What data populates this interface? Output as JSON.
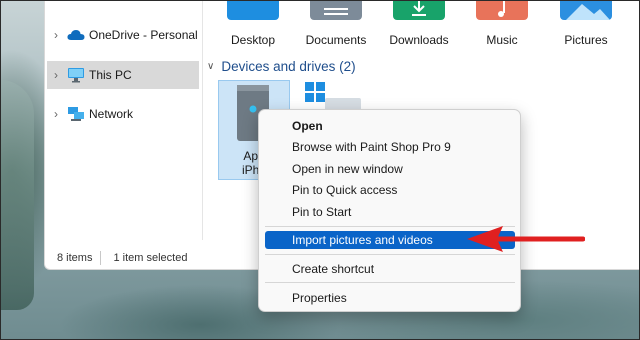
{
  "folders": [
    {
      "label": "Desktop",
      "icon": "desktop-folder-icon",
      "color": "#1e8ee0"
    },
    {
      "label": "Documents",
      "icon": "documents-folder-icon",
      "color": "#7d8b99"
    },
    {
      "label": "Downloads",
      "icon": "downloads-folder-icon",
      "color": "#18a36a"
    },
    {
      "label": "Music",
      "icon": "music-folder-icon",
      "color": "#e8735a"
    },
    {
      "label": "Pictures",
      "icon": "pictures-folder-icon",
      "color": "#2b8fe0"
    }
  ],
  "nav": {
    "items": [
      {
        "label": "OneDrive - Personal",
        "icon": "onedrive-cloud-icon",
        "selected": false
      },
      {
        "label": "This PC",
        "icon": "this-pc-monitor-icon",
        "selected": true
      },
      {
        "label": "Network",
        "icon": "network-icon",
        "selected": false
      }
    ]
  },
  "devices": {
    "header": "Devices and drives (2)",
    "drive_label_line1": "App",
    "drive_label_line2": "iPho"
  },
  "status": {
    "item_count": "8 items",
    "selection": "1 item selected"
  },
  "context_menu": {
    "items": [
      {
        "label": "Open",
        "bold": true
      },
      {
        "label": "Browse with Paint Shop Pro 9"
      },
      {
        "label": "Open in new window"
      },
      {
        "label": "Pin to Quick access"
      },
      {
        "label": "Pin to Start"
      },
      {
        "label": "Import pictures and videos",
        "highlighted": true
      },
      {
        "label": "Create shortcut"
      },
      {
        "label": "Properties"
      }
    ]
  },
  "colors": {
    "accent": "#0a64c8",
    "annotation_arrow": "#e02020",
    "selection_bg": "#cce4f7"
  }
}
